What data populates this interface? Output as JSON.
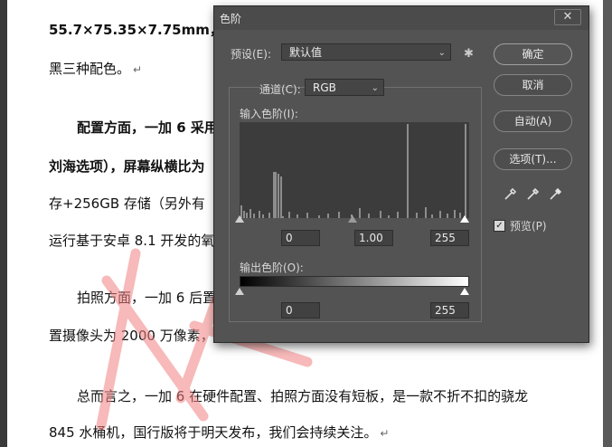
{
  "document": {
    "lines": [
      {
        "text": "55.7×75.35×7.75mm，",
        "bold": true
      },
      {
        "text": "黑三种配色。",
        "bold": false
      },
      {
        "text": "配置方面，一加 6 采用",
        "bold": true
      },
      {
        "text": "刘海选项），屏幕纵横比为",
        "bold": true
      },
      {
        "text": "存+256GB 存储（另外有",
        "bold": false
      },
      {
        "text": "运行基于安卓 8.1 开发的氧",
        "bold": false
      },
      {
        "text": "拍照方面，一加 6 后置",
        "bold": false
      },
      {
        "text": "置摄像头为 2000 万像素，",
        "bold": false
      },
      {
        "text": "总而言之，一加 6 在硬件配置、拍照方面没有短板，是一款不折不扣的骁龙",
        "bold": false
      },
      {
        "text": "845 水桶机，国行版将于明天发布，我们会持续关注。",
        "bold": false
      }
    ],
    "pilcrow": "↵"
  },
  "dialog": {
    "title": "色阶",
    "close_glyph": "✕",
    "preset_label": "预设(E):",
    "preset_value": "默认值",
    "channel_label": "通道(C):",
    "channel_value": "RGB",
    "input_levels_label": "输入色阶(I):",
    "input_black": "0",
    "input_gamma": "1.00",
    "input_white": "255",
    "output_levels_label": "输出色阶(O):",
    "output_black": "0",
    "output_white": "255",
    "buttons": {
      "ok": "确定",
      "cancel": "取消",
      "auto": "自动(A)",
      "options": "选项(T)..."
    },
    "preview_label": "预览(P)",
    "preview_checked": true,
    "icons": {
      "gear": "gear-icon",
      "dropper_black": "eyedropper-black-icon",
      "dropper_gray": "eyedropper-gray-icon",
      "dropper_white": "eyedropper-white-icon"
    }
  },
  "colors": {
    "dialog_bg": "#535353",
    "watermark": "#f08080"
  }
}
